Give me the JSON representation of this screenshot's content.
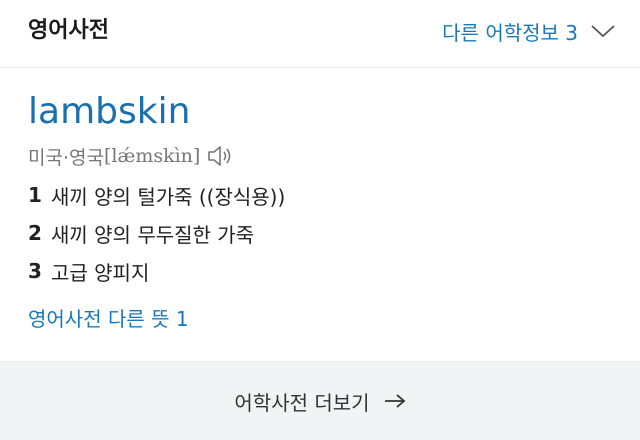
{
  "header": {
    "title": "영어사전",
    "more_label": "다른 어학정보 3"
  },
  "entry": {
    "word": "lambskin",
    "pron_region": "미국·영국",
    "pron_ipa": "[lǽmskìn]",
    "definitions": [
      {
        "num": "1",
        "text": "새끼 양의 털가죽 ((장식용))"
      },
      {
        "num": "2",
        "text": "새끼 양의 무두질한 가죽"
      },
      {
        "num": "3",
        "text": "고급 양피지"
      }
    ],
    "other_meanings": "영어사전 다른 뜻 1"
  },
  "footer": {
    "more_label": "어학사전 더보기"
  },
  "icons": {
    "chevron": "chevron-down-icon",
    "speaker": "speaker-icon",
    "arrow": "arrow-right-icon"
  },
  "colors": {
    "accent": "#1a78b8",
    "word": "#1a6fae",
    "footer_bg": "#f1f3f5"
  }
}
